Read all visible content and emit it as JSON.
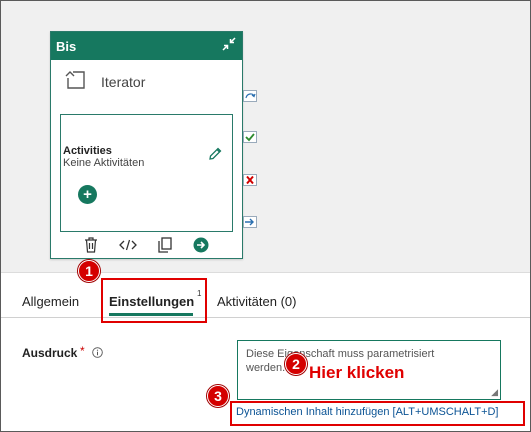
{
  "activity": {
    "title": "Bis",
    "iterator_label": "Iterator",
    "activities_title": "Activities",
    "activities_subtitle": "Keine Aktivitäten",
    "add_symbol": "+"
  },
  "tabs": [
    {
      "label": "Allgemein"
    },
    {
      "label": "Einstellungen",
      "badge": "1"
    },
    {
      "label": "Aktivitäten (0)"
    }
  ],
  "form": {
    "expression_label": "Ausdruck",
    "required_marker": "*",
    "placeholder": "Diese Eigenschaft muss parametrisiert werden.",
    "dynamic_link": "Dynamischen Inhalt hinzufügen [ALT+UMSCHALT+D]"
  },
  "annotations": {
    "step1": "1",
    "step2": "2",
    "step3": "3",
    "hint": "Hier klicken"
  },
  "colors": {
    "accent": "#16785f",
    "annotation": "#e00000",
    "canvas": "#f0f0f0"
  }
}
